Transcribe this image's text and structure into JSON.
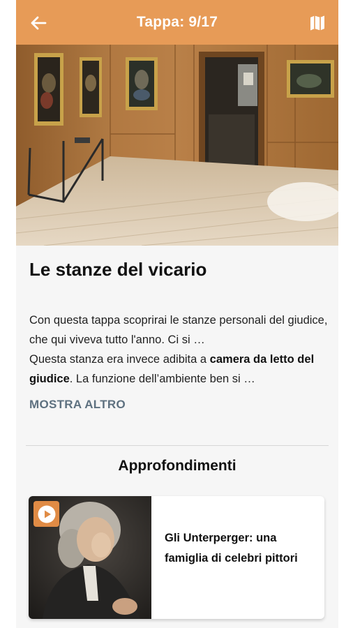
{
  "header": {
    "title": "Tappa: 9/17",
    "back_icon": "arrow-left-icon",
    "map_icon": "map-icon",
    "background_color": "#e79b57"
  },
  "stage": {
    "title": "Le stanze del vicario",
    "paragraph1": "Con questa tappa scoprirai le stanze personali del giudice, che qui viveva tutto l'anno. Ci si …",
    "paragraph2_prefix": "Questa stanza era invece adibita a ",
    "paragraph2_bold": "camera da letto del giudice",
    "paragraph2_suffix": ". La funzione dell’ambiente ben si …",
    "more_label": "MOSTRA ALTRO"
  },
  "insights": {
    "title": "Approfondimenti",
    "cards": [
      {
        "title": "Gli Unterperger: una famiglia di celebri pittori",
        "icon": "play-icon",
        "accent_color": "#e08b45"
      }
    ]
  }
}
